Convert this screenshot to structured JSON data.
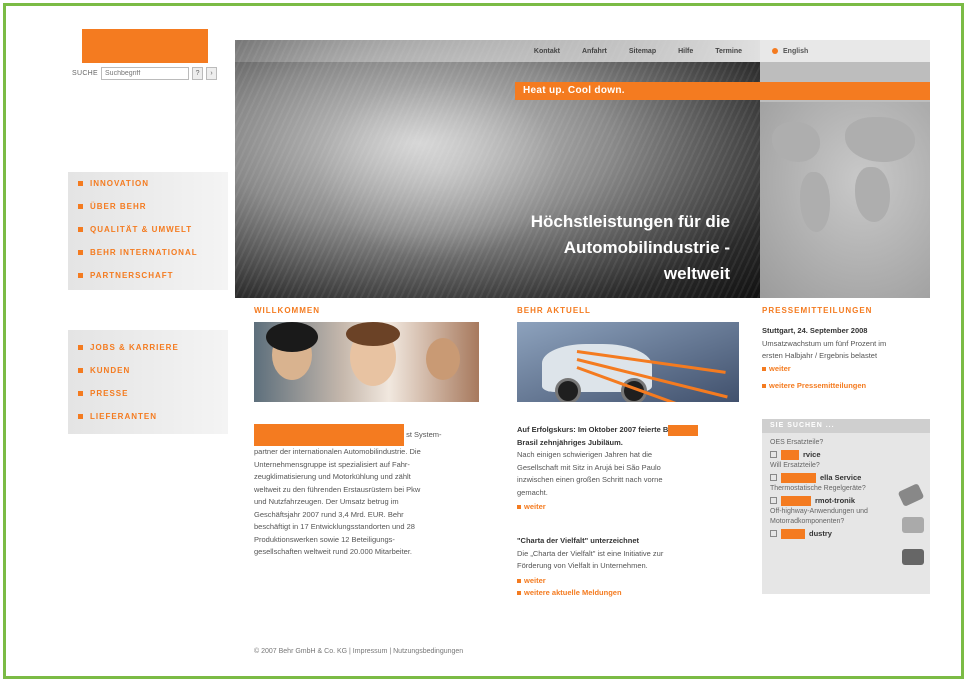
{
  "topnav": [
    "Kontakt",
    "Anfahrt",
    "Sitemap",
    "Hilfe",
    "Termine"
  ],
  "language": "English",
  "search": {
    "label": "SUCHE",
    "placeholder": "Suchbegriff",
    "go": "?"
  },
  "banner": "Heat up. Cool down.",
  "headline": [
    "Höchstleistungen für die",
    "Automobilindustrie -",
    "weltweit"
  ],
  "nav_primary": [
    "INNOVATION",
    "ÜBER BEHR",
    "QUALITÄT & UMWELT",
    "BEHR INTERNATIONAL",
    "PARTNERSCHAFT"
  ],
  "nav_secondary": [
    "JOBS & KARRIERE",
    "KUNDEN",
    "PRESSE",
    "LIEFERANTEN"
  ],
  "willkommen": {
    "heading": "WILLKOMMEN",
    "text": [
      "st System-",
      "partner der internationalen Automobilindustrie. Die",
      "Unternehmensgruppe ist spezialisiert auf Fahr-",
      "zeugklimatisierung und Motorkühlung und zählt",
      "weltweit zu den führenden Erstausrüstern bei Pkw",
      "und Nutzfahrzeugen. Der Umsatz betrug im",
      "Geschäftsjahr 2007 rund 3,4 Mrd. EUR. Behr",
      "beschäftigt in 17 Entwicklungsstandorten und 28",
      "Produktionswerken sowie 12 Beteiligungs-",
      "gesellschaften weltweit rund 20.000 Mitarbeiter."
    ]
  },
  "aktuell": {
    "heading": "BEHR AKTUELL",
    "news1_title": [
      "Auf Erfolgskurs: Im Oktober 2007 feierte B",
      "Brasil zehnjähriges Jubiläum."
    ],
    "news1_text": [
      "Nach einigen schwierigen Jahren hat die",
      "Gesellschaft mit Sitz in Arujá bei São Paulo",
      "inzwischen einen großen Schritt nach vorne",
      "gemacht."
    ],
    "more1": "weiter",
    "news2_title": "\"Charta der Vielfalt\" unterzeichnet",
    "news2_text": [
      "Die „Charta der Vielfalt\" ist eine Initiative zur",
      "Förderung von Vielfalt in Unternehmen."
    ],
    "more2": "weiter",
    "more_all": "weitere aktuelle Meldungen"
  },
  "presse": {
    "heading": "PRESSEMITTEILUNGEN",
    "title": "Stuttgart, 24. September 2008",
    "text": [
      "Umsatzwachstum um fünf Prozent im",
      "ersten Halbjahr / Ergebnis belastet"
    ],
    "more": "weiter",
    "more_all": "weitere Pressemitteilungen"
  },
  "finder": {
    "heading": "SIE SUCHEN ...",
    "items": [
      {
        "q": "OES Ersatzteile?",
        "link": "rvice"
      },
      {
        "q": "Will Ersatzteile?",
        "link": "ella Service"
      },
      {
        "q": "Thermostatische Regelgeräte?",
        "link": "rmot-tronik"
      },
      {
        "q": "Off-highway-Anwendungen und Motorradkomponenten?",
        "link": "dustry"
      }
    ]
  },
  "footer": "© 2007 Behr GmbH & Co. KG | Impressum | Nutzungsbedingungen",
  "colors": {
    "accent": "#f47b20",
    "frame": "#7bbb45"
  }
}
